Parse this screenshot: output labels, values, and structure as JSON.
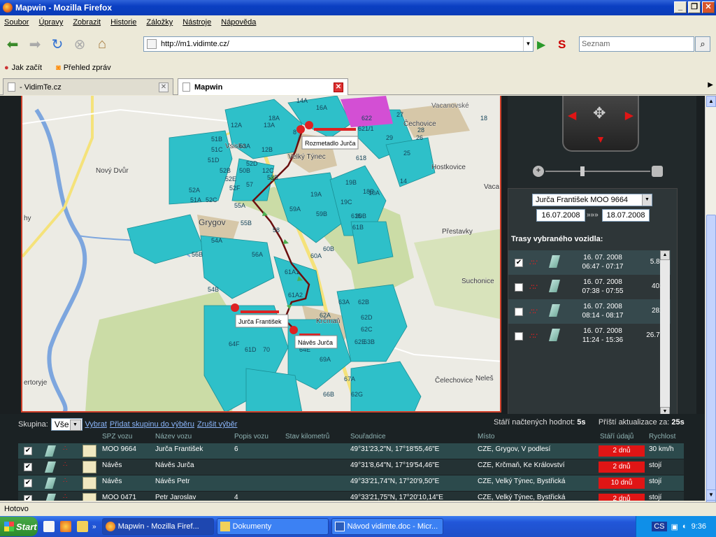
{
  "window": {
    "title": "Mapwin - Mozilla Firefox"
  },
  "menu": [
    "Soubor",
    "Úpravy",
    "Zobrazit",
    "Historie",
    "Záložky",
    "Nástroje",
    "Nápověda"
  ],
  "url": "http://m1.vidimte.cz/",
  "search_placeholder": "Seznam",
  "bookmarks": [
    "Jak začít",
    "Přehled zpráv"
  ],
  "tabs": [
    "- VidimTe.cz",
    "Mapwin"
  ],
  "map": {
    "places": [
      "Vsisko",
      "Velký Týnec",
      "Nový Dvůr",
      "Grygov",
      "Hostkovice",
      "Přestavky",
      "Suchonice",
      "Krčmaň",
      "Čechovice",
      "Čelechovice",
      "Vacanovské",
      "Vaca",
      "Neleš",
      "ertoryje",
      "hy"
    ],
    "markers": [
      "Rozmetadlo Jurča",
      "Jurča František",
      "Návěs Jurča"
    ],
    "parcels": [
      "14A",
      "16A",
      "18A",
      "13A",
      "12A",
      "51B",
      "51C",
      "51D",
      "50B",
      "52B",
      "53A",
      "52D",
      "12B",
      "12C",
      "53B",
      "52A",
      "51A",
      "52C",
      "52E",
      "52F",
      "57",
      "55A",
      "55B",
      "56A",
      "56B",
      "54A",
      "54B",
      "58",
      "59A",
      "59B",
      "60A",
      "60B",
      "61A1",
      "61A2",
      "19A",
      "19B",
      "18B",
      "19C",
      "10A",
      "30B",
      "61B",
      "62A",
      "63A",
      "62B",
      "62D",
      "62C",
      "63B",
      "62E",
      "64E",
      "64F",
      "61D",
      "70",
      "69A",
      "67A",
      "66B",
      "62G",
      "615",
      "618",
      "622",
      "621/1",
      "27",
      "28",
      "26",
      "25",
      "18",
      "29",
      "14",
      "8"
    ]
  },
  "sidebar": {
    "vehicle": "Jurča František MOO 9664",
    "date_from": "16.07.2008",
    "date_sep": "»»»",
    "date_to": "18.07.2008",
    "trasy_title": "Trasy vybraného vozidla:",
    "routes": [
      {
        "date": "16. 07. 2008",
        "time": "06:47 - 07:17",
        "km": "5.8km",
        "checked": true
      },
      {
        "date": "16. 07. 2008",
        "time": "07:38 - 07:55",
        "km": "403m",
        "checked": false
      },
      {
        "date": "16. 07. 2008",
        "time": "08:14 - 08:17",
        "km": "282m",
        "checked": false
      },
      {
        "date": "16. 07. 2008",
        "time": "11:24 - 15:36",
        "km": "26.7km",
        "checked": false
      }
    ]
  },
  "bottom": {
    "skupina_label": "Skupina:",
    "skupina_value": "Vše",
    "link_vybrat": "Vybrat",
    "link_pridat": "Přidat skupinu do výběru",
    "link_zrusit": "Zrušit výběr",
    "stari_label": "Stáří načtených hodnot:",
    "stari_value": "5s",
    "pristi_label": "Příští aktualizace za:",
    "pristi_value": "25s"
  },
  "table": {
    "columns": [
      "SPZ vozu",
      "Název vozu",
      "Popis vozu",
      "Stav kilometrů",
      "Souřadnice",
      "Místo",
      "Stáří údajů",
      "Rychlost"
    ],
    "rows": [
      {
        "spz": "MOO 9664",
        "nazev": "Jurča František",
        "popis": "6",
        "stav": "",
        "sour": "49°31'23,2\"N, 17°18'55,46\"E",
        "misto": "CZE, Grygov, V podlesí",
        "stari": "2 dnů",
        "rychlost": "30 km/h"
      },
      {
        "spz": "Návěs",
        "nazev": "Návěs Jurča",
        "popis": "",
        "stav": "",
        "sour": "49°31'8,64\"N, 17°19'54,46\"E",
        "misto": "CZE, Krčmaň, Ke Království",
        "stari": "2 dnů",
        "rychlost": "stojí"
      },
      {
        "spz": "Návěs",
        "nazev": "Návěs Petr",
        "popis": "",
        "stav": "",
        "sour": "49°33'21,74\"N, 17°20'9,50\"E",
        "misto": "CZE, Velký Týnec, Bystřická",
        "stari": "10 dnů",
        "rychlost": "stojí"
      },
      {
        "spz": "MOO 0471",
        "nazev": "Petr Jaroslav",
        "popis": "4",
        "stav": "",
        "sour": "49°33'21,75\"N, 17°20'10,14\"E",
        "misto": "CZE, Velký Týnec, Bystřická",
        "stari": "2 dnů",
        "rychlost": "stojí"
      }
    ]
  },
  "status": "Hotovo",
  "taskbar": {
    "start": "Start",
    "items": [
      "Mapwin - Mozilla Firef...",
      "Dokumenty",
      "Návod vidimte.doc - Micr..."
    ],
    "tray_lang": "CS",
    "clock": "9:36"
  },
  "colors": {
    "parcel": "#2ec0c9",
    "parcel_border": "#1b8f96",
    "urban": "#d2c3a6",
    "forest": "#c5d9a4",
    "road": "#f6e26a",
    "river": "#6f9bd6",
    "route": "#7a1010",
    "magenta": "#d34fd4",
    "accent_red": "#e01515"
  }
}
